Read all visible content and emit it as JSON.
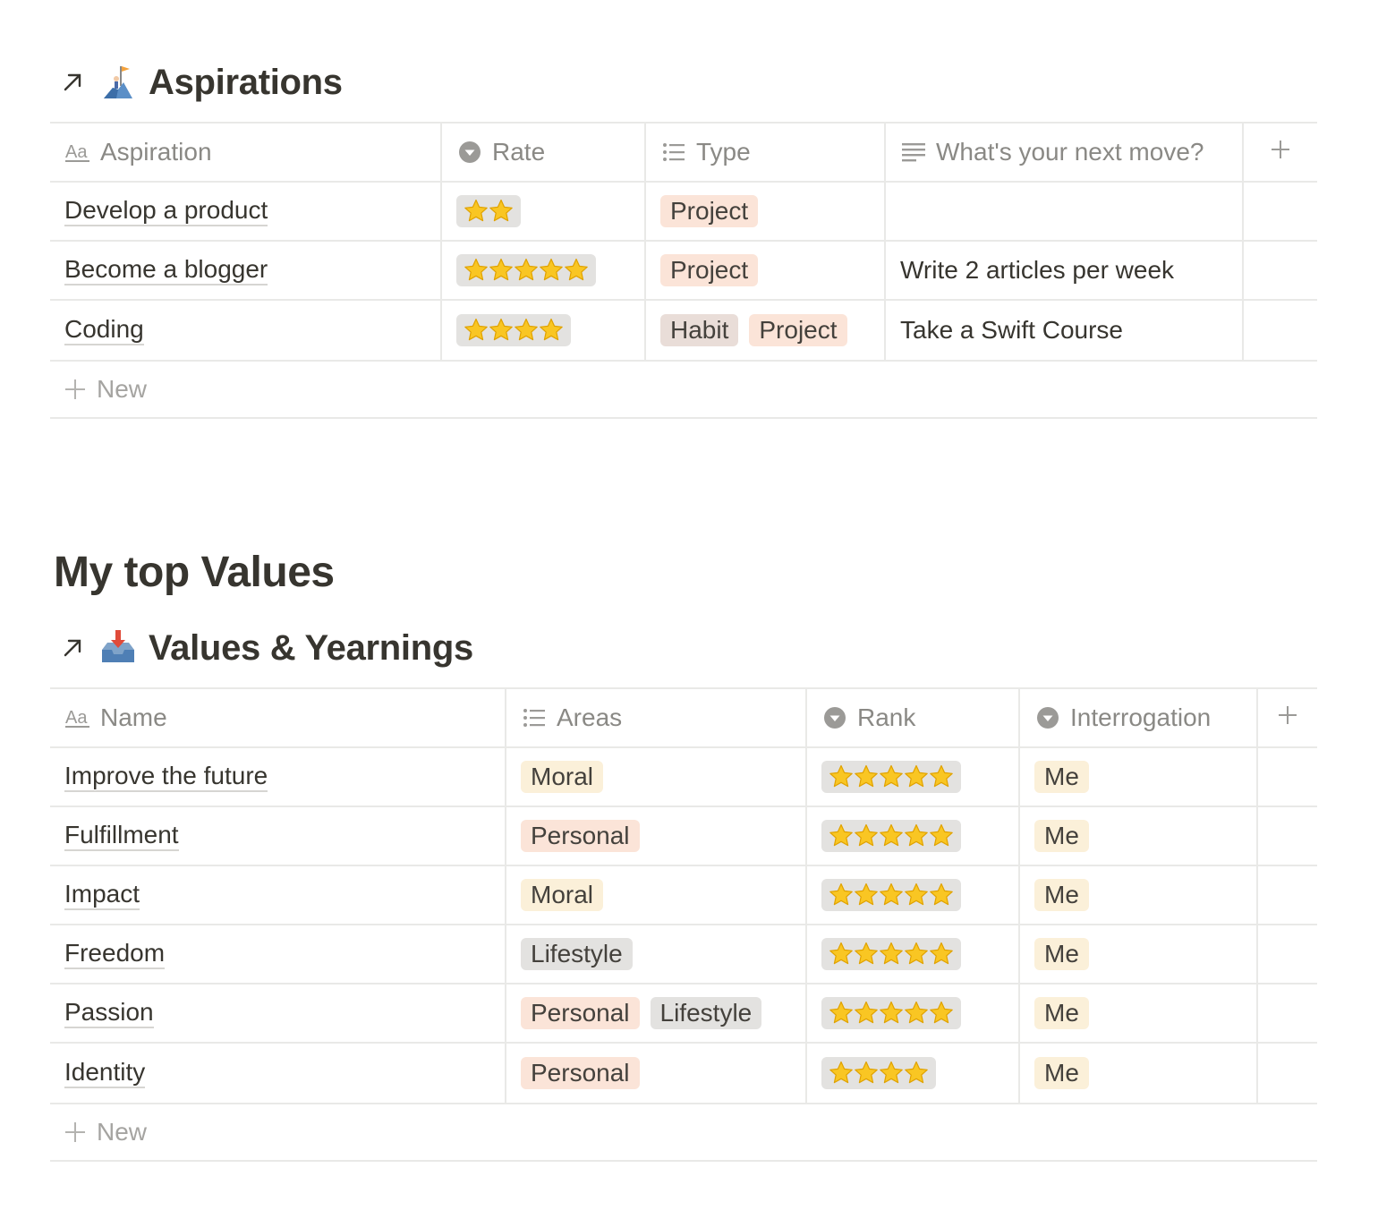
{
  "aspirations": {
    "title": "Aspirations",
    "columns": [
      "Aspiration",
      "Rate",
      "Type",
      "What's your next move?"
    ],
    "rows": [
      {
        "name": "Develop a product",
        "rate": 2,
        "types": [
          "Project"
        ],
        "next_move": ""
      },
      {
        "name": "Become a blogger",
        "rate": 5,
        "types": [
          "Project"
        ],
        "next_move": "Write 2 articles per week"
      },
      {
        "name": "Coding",
        "rate": 4,
        "types": [
          "Habit",
          "Project"
        ],
        "next_move": "Take a Swift Course"
      }
    ],
    "new_label": "New"
  },
  "section_heading": "My top Values",
  "values": {
    "title": "Values & Yearnings",
    "columns": [
      "Name",
      "Areas",
      "Rank",
      "Interrogation"
    ],
    "rows": [
      {
        "name": "Improve the future",
        "areas": [
          "Moral"
        ],
        "rank": 5,
        "interrogation": "Me"
      },
      {
        "name": "Fulfillment",
        "areas": [
          "Personal"
        ],
        "rank": 5,
        "interrogation": "Me"
      },
      {
        "name": "Impact",
        "areas": [
          "Moral"
        ],
        "rank": 5,
        "interrogation": "Me"
      },
      {
        "name": "Freedom",
        "areas": [
          "Lifestyle"
        ],
        "rank": 5,
        "interrogation": "Me"
      },
      {
        "name": "Passion",
        "areas": [
          "Personal",
          "Lifestyle"
        ],
        "rank": 5,
        "interrogation": "Me"
      },
      {
        "name": "Identity",
        "areas": [
          "Personal"
        ],
        "rank": 4,
        "interrogation": "Me"
      }
    ],
    "new_label": "New"
  },
  "tag_colors": {
    "Project": "#fbe4d8",
    "Habit": "#e9ddd8",
    "Moral": "#fbf0d9",
    "Personal": "#fbe4d8",
    "Lifestyle": "#e3e2e0",
    "Me": "#fbf0d9"
  },
  "icons": {
    "open": "arrow-up-right-icon",
    "aspirations_emoji": "climbing-flag-icon",
    "values_emoji": "inbox-tray-icon",
    "title_property": "text-aa-icon",
    "select_property": "select-chevron-circle-icon",
    "multiselect_property": "list-icon",
    "text_property": "paragraph-lines-icon",
    "add": "plus-icon"
  }
}
